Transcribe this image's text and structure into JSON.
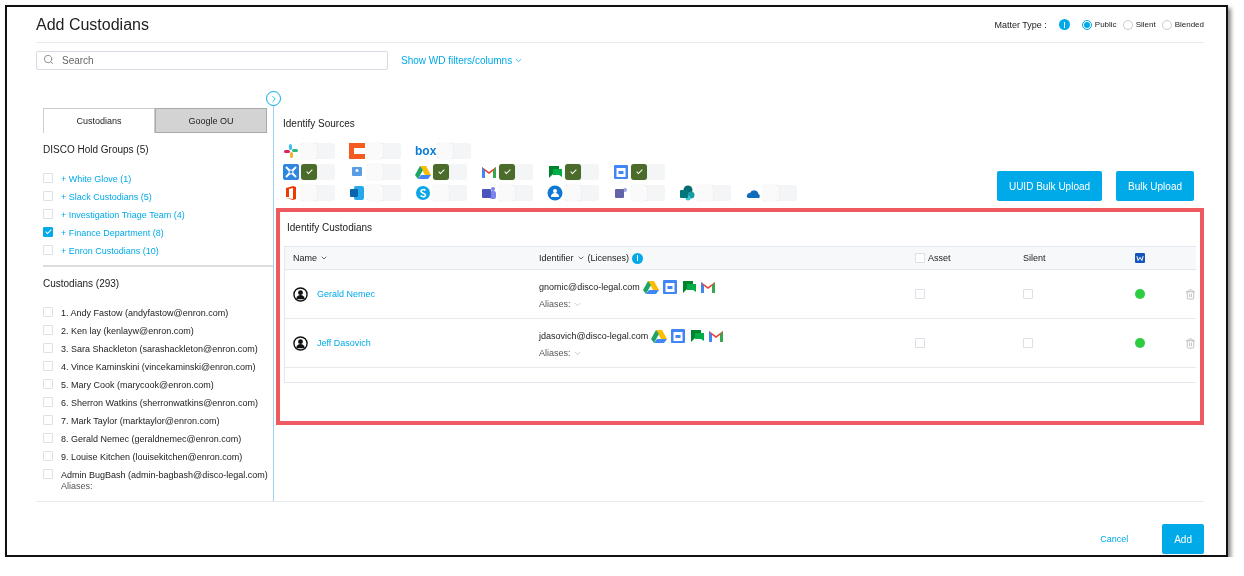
{
  "title": "Add Custodians",
  "matter_type": {
    "label": "Matter Type :",
    "options": [
      {
        "label": "Public",
        "selected": true
      },
      {
        "label": "Silent",
        "selected": false
      },
      {
        "label": "Blended",
        "selected": false
      }
    ]
  },
  "search": {
    "placeholder": "Search"
  },
  "filters_link": "Show WD filters/columns",
  "left_panel": {
    "tabs": [
      {
        "label": "Custodians",
        "selected": true
      },
      {
        "label": "Google OU",
        "selected": false
      }
    ],
    "groups_heading": "DISCO Hold Groups (5)",
    "groups": [
      {
        "label": "+ White Glove (1)",
        "checked": false
      },
      {
        "label": "+ Slack Custodians (5)",
        "checked": false
      },
      {
        "label": "+ Investigation Triage Team (4)",
        "checked": false
      },
      {
        "label": "+ Finance Department (8)",
        "checked": true
      },
      {
        "label": "+ Enron Custodians (10)",
        "checked": false
      }
    ],
    "custodians_heading": "Custodians (293)",
    "custodians": [
      {
        "label": "1. Andy Fastow (andyfastow@enron.com)",
        "checked": false
      },
      {
        "label": "2. Ken lay (kenlayw@enron.com)",
        "checked": false
      },
      {
        "label": "3. Sara Shackleton (sarashackleton@enron.com)",
        "checked": false
      },
      {
        "label": "4. Vince Kaminskini (vincekaminski@enron.com)",
        "checked": false
      },
      {
        "label": "5. Mary Cook (marycook@enron.com)",
        "checked": false
      },
      {
        "label": "6. Sherron Watkins (sherronwatkins@enron.com)",
        "checked": false
      },
      {
        "label": "7. Mark Taylor (marktaylor@enron.com)",
        "checked": false
      },
      {
        "label": "8. Gerald Nemec (geraldnemec@enron.com)",
        "checked": false
      },
      {
        "label": "9. Louise Kitchen (louisekitchen@enron.com)",
        "checked": false
      },
      {
        "label": "Admin BugBash (admin-bagbash@disco-legal.com)",
        "checked": false,
        "aliases": "Aliases:"
      }
    ]
  },
  "sources": {
    "heading": "Identify Sources",
    "rows": [
      [
        {
          "kind": "slack",
          "checked": false
        },
        {
          "kind": "orange",
          "checked": false
        },
        {
          "kind": "box",
          "label": "box",
          "checked": false
        }
      ],
      [
        {
          "kind": "cross",
          "checked": true
        },
        {
          "kind": "contact",
          "checked": false
        },
        {
          "kind": "drive",
          "checked": true
        },
        {
          "kind": "gmail",
          "checked": true
        },
        {
          "kind": "chat",
          "checked": true
        },
        {
          "kind": "calendar",
          "checked": true
        }
      ],
      [
        {
          "kind": "office",
          "checked": false
        },
        {
          "kind": "exchange",
          "checked": false
        },
        {
          "kind": "skype",
          "checked": false
        },
        {
          "kind": "teams",
          "checked": false
        },
        {
          "kind": "people",
          "checked": false
        },
        {
          "kind": "teams2",
          "checked": false
        },
        {
          "kind": "sharepoint",
          "checked": false
        },
        {
          "kind": "onedrive",
          "checked": false
        }
      ]
    ]
  },
  "upload_buttons": [
    "UUID Bulk Upload",
    "Bulk Upload"
  ],
  "custodians_section": {
    "heading": "Identify Custodians",
    "highlighted": true,
    "columns": {
      "name": "Name",
      "identifier": "Identifier",
      "licenses": "(Licenses)",
      "asset": "Asset",
      "silent": "Silent"
    },
    "asset_all_checked": false,
    "rows": [
      {
        "name": "Gerald Nemec",
        "email": "gnomic@disco-legal.com",
        "licenses": [
          {
            "kind": "drive"
          },
          {
            "kind": "calendar"
          },
          {
            "kind": "chat"
          },
          {
            "kind": "gmail"
          }
        ],
        "aliases": "Aliases:",
        "asset": false,
        "silent": false,
        "color": "#2ecc40"
      },
      {
        "name": "Jeff Dasovich",
        "email": "jdasovich@disco-legal.com",
        "licenses": [
          {
            "kind": "drive"
          },
          {
            "kind": "calendar"
          },
          {
            "kind": "chat"
          },
          {
            "kind": "gmail"
          }
        ],
        "aliases": "Aliases:",
        "asset": false,
        "silent": false,
        "color": "#2ecc40"
      }
    ]
  },
  "footer_buttons": {
    "cancel": "Cancel",
    "add": "Add"
  }
}
